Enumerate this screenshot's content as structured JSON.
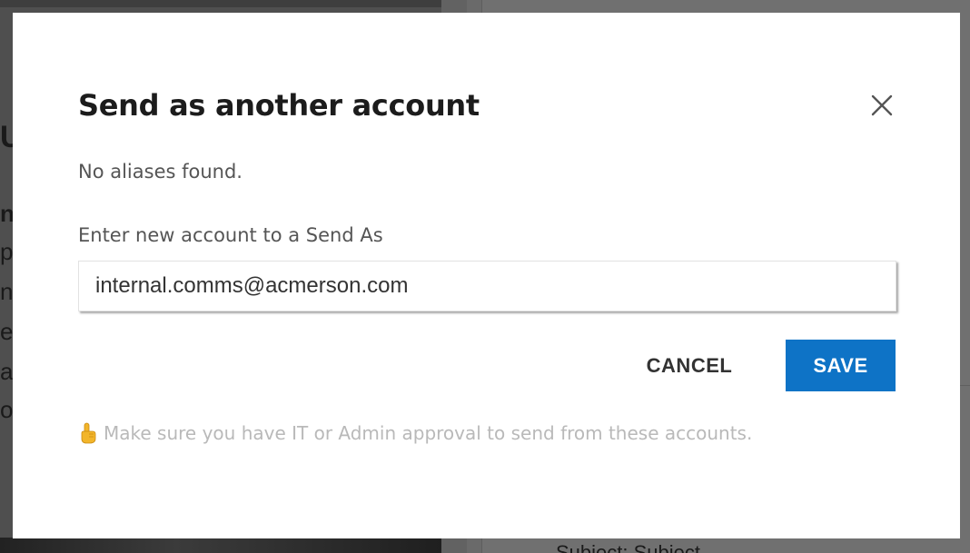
{
  "background": {
    "fragments": [
      "U",
      "n",
      "p",
      "n",
      "e",
      "a",
      "o"
    ],
    "subject_text": "Subject: Subject"
  },
  "dialog": {
    "title": "Send as another account",
    "close_icon": "close-icon",
    "no_aliases_text": "No aliases found.",
    "field_label": "Enter new account to a Send As",
    "email_value": "internal.comms@acmerson.com",
    "cancel_label": "CANCEL",
    "save_label": "SAVE",
    "hint_icon": "pointing-hand-icon",
    "hint_text": "Make sure you have IT or Admin approval to send from these accounts.",
    "colors": {
      "save_button": "#0e73c6",
      "hint_text": "#b9b9b9",
      "title": "#1c1c1c"
    }
  }
}
